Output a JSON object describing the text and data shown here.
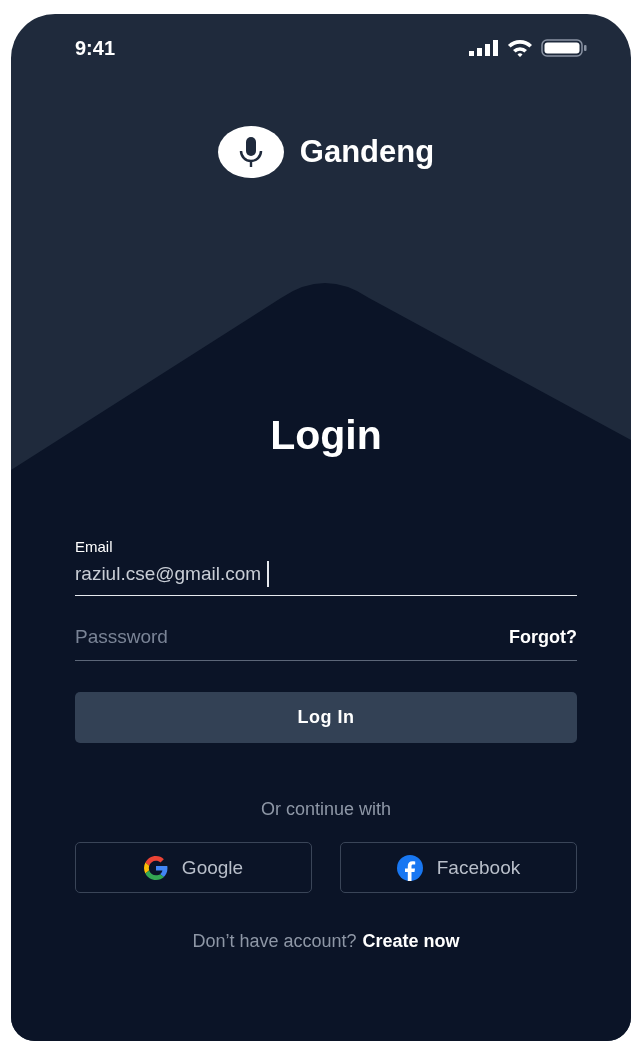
{
  "status_bar": {
    "time": "9:41"
  },
  "brand": {
    "name": "Gandeng"
  },
  "title": "Login",
  "email": {
    "label": "Email",
    "value": "raziul.cse@gmail.com",
    "focused": true
  },
  "password": {
    "placeholder": "Passsword",
    "link": "Forgot?"
  },
  "login_button": "Log In",
  "divider_text": "Or continue with",
  "social_buttons": [
    {
      "kind": "google",
      "label": "Google"
    },
    {
      "kind": "facebook",
      "label": "Facebook"
    }
  ],
  "footer": {
    "text": "Don’t have account?",
    "link": "Create now"
  }
}
